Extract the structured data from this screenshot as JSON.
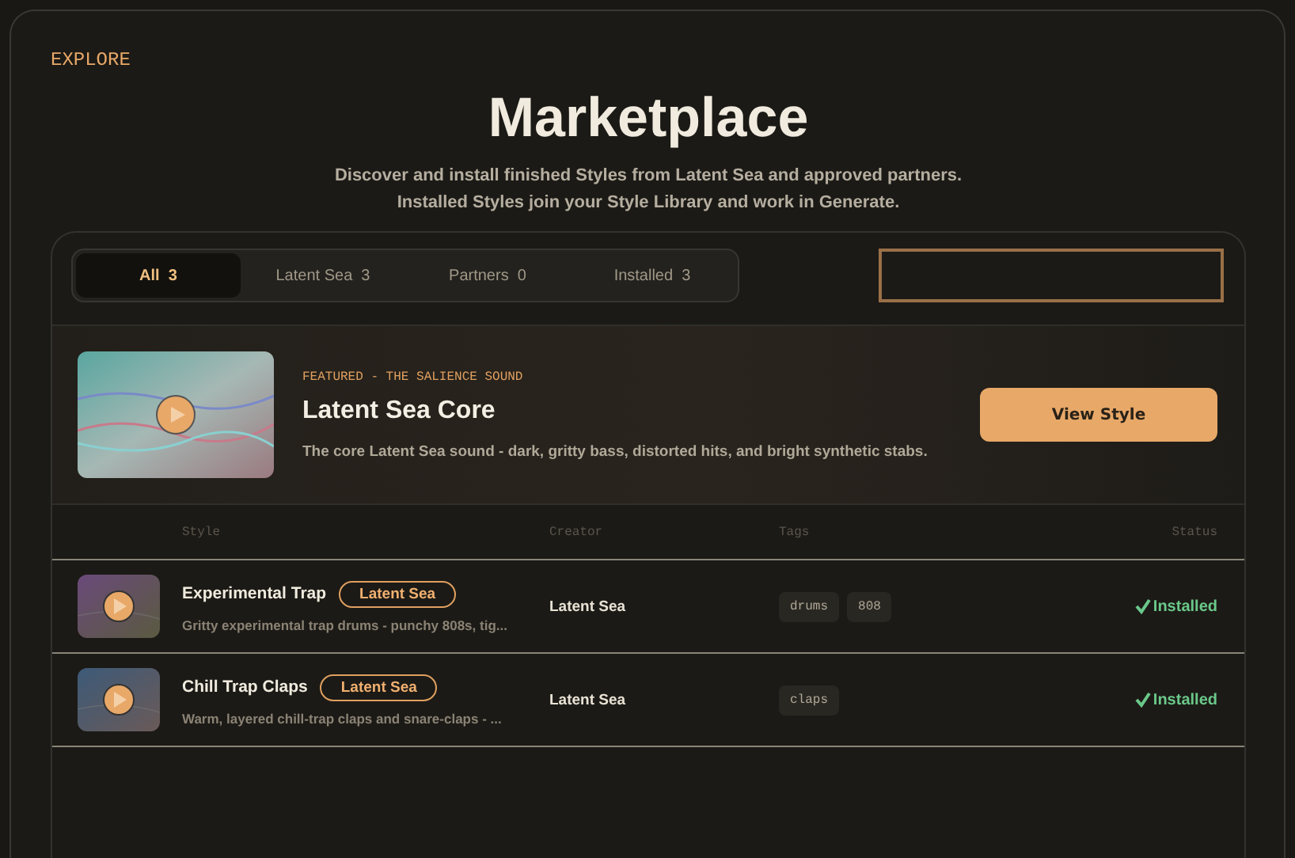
{
  "eyebrow": "EXPLORE",
  "title": "Marketplace",
  "subtitle": [
    "Discover and install finished Styles from Latent Sea and approved partners.",
    "Installed Styles join your Style Library and work in Generate."
  ],
  "tabs": [
    {
      "label": "All",
      "count": "3",
      "selected": true
    },
    {
      "label": "Latent Sea",
      "count": "3",
      "selected": false
    },
    {
      "label": "Partners",
      "count": "0",
      "selected": false
    },
    {
      "label": "Installed",
      "count": "3",
      "selected": false
    }
  ],
  "featured": {
    "eyebrow": "FEATURED - THE SALIENCE SOUND",
    "title": "Latent Sea Core",
    "description": "The core Latent Sea sound - dark, gritty bass, distorted hits, and bright synthetic stabs.",
    "button": "View Style"
  },
  "table": {
    "columns": [
      "Style",
      "Creator",
      "Tags",
      "Status"
    ],
    "rows": [
      {
        "name": "Experimental Trap",
        "badge": "Latent Sea",
        "description": "Gritty experimental trap drums - punchy 808s, tig...",
        "creator": "Latent Sea",
        "tags": [
          "drums",
          "808"
        ],
        "status": "Installed",
        "installed": true
      },
      {
        "name": "Chill Trap Claps",
        "badge": "Latent Sea",
        "description": "Warm, layered chill-trap claps and snare-claps - ...",
        "creator": "Latent Sea",
        "tags": [
          "claps"
        ],
        "status": "Installed",
        "installed": true
      }
    ]
  }
}
